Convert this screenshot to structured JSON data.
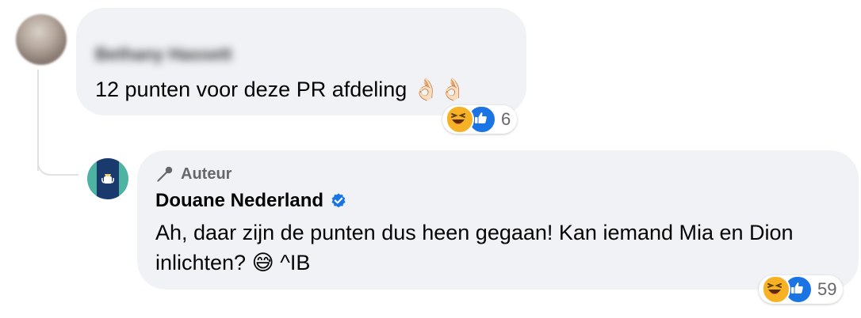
{
  "comment": {
    "author_name_blurred": "Bethany Hassett",
    "text": "12 punten voor deze PR afdeling",
    "text_emoji": "👌🏻👌🏻",
    "reactions": {
      "types": [
        "haha-icon",
        "like-icon"
      ],
      "count": "6"
    }
  },
  "reply": {
    "badge": "Auteur",
    "author": "Douane Nederland",
    "text": "Ah, daar zijn de punten dus heen gegaan! Kan iemand Mia en Dion inlichten?",
    "text_emoji": "😅",
    "signature": "^IB",
    "reactions": {
      "types": [
        "haha-icon",
        "like-icon"
      ],
      "count": "59"
    }
  },
  "colors": {
    "bubble": "#f0f2f5",
    "secondary_text": "#65676b",
    "verified": "#1b74e4",
    "like": "#1b74e4",
    "haha": "#f7b125",
    "avatar_teal": "#4fb3a4",
    "avatar_navy": "#1a3a6e"
  }
}
